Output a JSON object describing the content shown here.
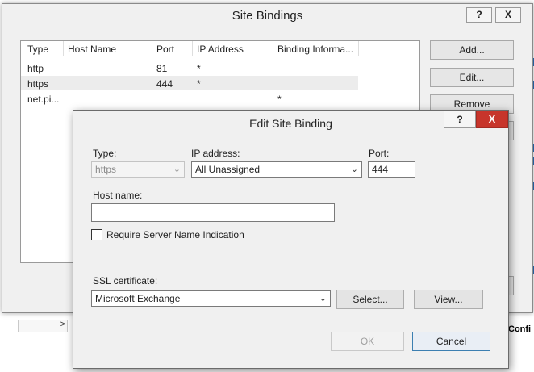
{
  "site_bindings": {
    "title": "Site Bindings",
    "help_label": "?",
    "close_label": "X",
    "columns": [
      "Type",
      "Host Name",
      "Port",
      "IP Address",
      "Binding Informa..."
    ],
    "rows": [
      {
        "type": "http",
        "host": "",
        "port": "81",
        "ip": "*",
        "info": ""
      },
      {
        "type": "https",
        "host": "",
        "port": "444",
        "ip": "*",
        "info": ""
      },
      {
        "type": "net.pi...",
        "host": "",
        "port": "",
        "ip": "",
        "info": "*"
      }
    ],
    "buttons": {
      "add": "Add...",
      "edit": "Edit...",
      "remove": "Remove"
    }
  },
  "edit_binding": {
    "title": "Edit Site Binding",
    "help_label": "?",
    "close_label": "X",
    "type_label": "Type:",
    "type_value": "https",
    "ip_label": "IP address:",
    "ip_value": "All Unassigned",
    "port_label": "Port:",
    "port_value": "444",
    "host_label": "Host name:",
    "host_value": "",
    "sni_label": "Require Server Name Indication",
    "sni_checked": false,
    "ssl_label": "SSL certificate:",
    "ssl_value": "Microsoft Exchange",
    "select_label": "Select...",
    "view_label": "View...",
    "ok_label": "OK",
    "cancel_label": "Cancel"
  },
  "background": {
    "scroll_arrow": ">",
    "config_text": "Confi"
  },
  "colors": {
    "close_red": "#c7352b",
    "default_button_border": "#3c7fb1",
    "background_accent": "#2a6fb8"
  },
  "icons": {
    "dropdown": "chevron-down-icon"
  }
}
